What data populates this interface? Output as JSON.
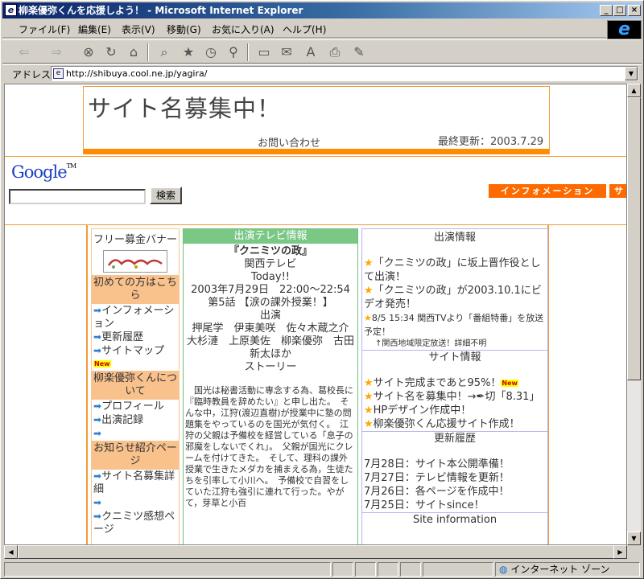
{
  "window": {
    "title": "柳楽優弥くんを応援しよう！ - Microsoft Internet Explorer",
    "minimize": "_",
    "maximize": "□",
    "close": "×"
  },
  "menu": [
    "ファイル(F)",
    "編集(E)",
    "表示(V)",
    "移動(G)",
    "お気に入り(A)",
    "ヘルプ(H)"
  ],
  "address": {
    "label": "アドレス",
    "url": "http://shibuya.cool.ne.jp/yagira/"
  },
  "status": {
    "zone": "インターネット ゾーン"
  },
  "header": {
    "site_title": "サイト名募集中！",
    "contact": "お問い合わせ",
    "updated": "最終更新：2003.7.29"
  },
  "google": {
    "logo": "Google",
    "tm": "TM",
    "search_button": "検索"
  },
  "tabs": {
    "info": "インフォメーション",
    "next": "サ"
  },
  "left": {
    "banner_title": "フリー募金バナー",
    "sec1": "初めての方はこちら",
    "items1": [
      "インフォメーション",
      "更新履歴",
      "サイトマップ"
    ],
    "new": "New",
    "sec2": "柳楽優弥くんについて",
    "items2": [
      "プロフィール",
      "出演記録",
      ""
    ],
    "sec3": "お知らせ紹介ページ",
    "items3": [
      "サイト名募集詳細",
      "",
      "クニミツ感想ページ"
    ]
  },
  "middle": {
    "head": "出演テレビ情報",
    "show": "『クニミツの政』",
    "network": "関西テレビ",
    "today": "Today!!",
    "airtime": "2003年7月29日　22:00〜22:54",
    "episode": "第5話 【涙の課外授業！】",
    "cast_label": "出演",
    "cast": "押尾学　伊東美咲　佐々木蔵之介　大杉漣　上原美佐　柳楽優弥　古田新太ほか",
    "story_label": "ストーリー",
    "story": "　国光は秘書活動に専念する為、葛校長に『臨時教員を辞めたい』と申し出た。　そんな中，江狩(渡辺直樹)が授業中に塾の問題集をやっているのを国光が気付く。　江狩の父親は予備校を経営している「息子の邪魔をしないでくれ」。　父親が国光にクレームを付けてきた。　そして、理科の課外授業で生きたメダカを捕まえる為，生徒たちを引率して小川へ。　予備校で自習をしていた江狩も強引に連れて行った。やがて，芽草と小百"
  },
  "right": {
    "head1": "出演情報",
    "items1": [
      "「クニミツの政」に坂上晋作役として出演！",
      "「クニミツの政」が2003.10.1にビデオ発売！"
    ],
    "news": "8/5 15:34 関西TVより「番組特番」を放送予定！",
    "note": "↑関西地域限定放送！詳細不明",
    "head2": "サイト情報",
    "items2": [
      "サイト完成まであと95%！",
      "サイト名を募集中！→✒切「8.31」",
      "HPデザイン作成中！",
      "柳楽優弥くん応援サイト作成！"
    ],
    "head3": "更新履歴",
    "history": [
      "7月28日：サイト本公開準備！",
      "7月27日：テレビ情報を更新！",
      "7月26日：各ページを作成中！",
      "7月25日：サイトsince！"
    ],
    "head4": "Site information"
  }
}
